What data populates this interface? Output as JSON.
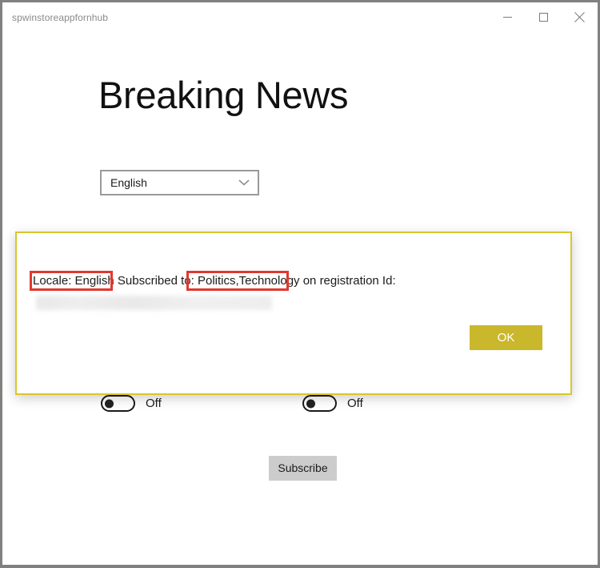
{
  "window": {
    "title": "spwinstoreappfornhub",
    "controls": {
      "minimize": "minimize-button",
      "maximize": "maximize-button",
      "close": "close-button"
    },
    "frame_color": "#808080"
  },
  "main": {
    "heading": "Breaking News",
    "locale_select": {
      "value": "English",
      "icon": "chevron-down-icon"
    },
    "toggles": [
      {
        "label": "Off",
        "state": "off"
      },
      {
        "label": "Off",
        "state": "off"
      }
    ],
    "subscribe_button": {
      "label": "Subscribe",
      "background": "#cccccc"
    }
  },
  "dialog": {
    "border_color": "#d9c62b",
    "message_parts": {
      "locale": "Locale: English",
      "middle": " Subscribed to: ",
      "topics": "Politics,Technology",
      "tail": " on registration Id:"
    },
    "registration_id": "",
    "registration_id_state": "redacted",
    "ok_button": {
      "label": "OK",
      "background": "#c9b72c",
      "text_color": "#ffffff"
    }
  },
  "annotations": [
    {
      "name": "locale-highlight",
      "target": "Locale: English",
      "color": "#e0392e"
    },
    {
      "name": "topics-highlight",
      "target": "Politics,Technology",
      "color": "#e0392e"
    }
  ]
}
